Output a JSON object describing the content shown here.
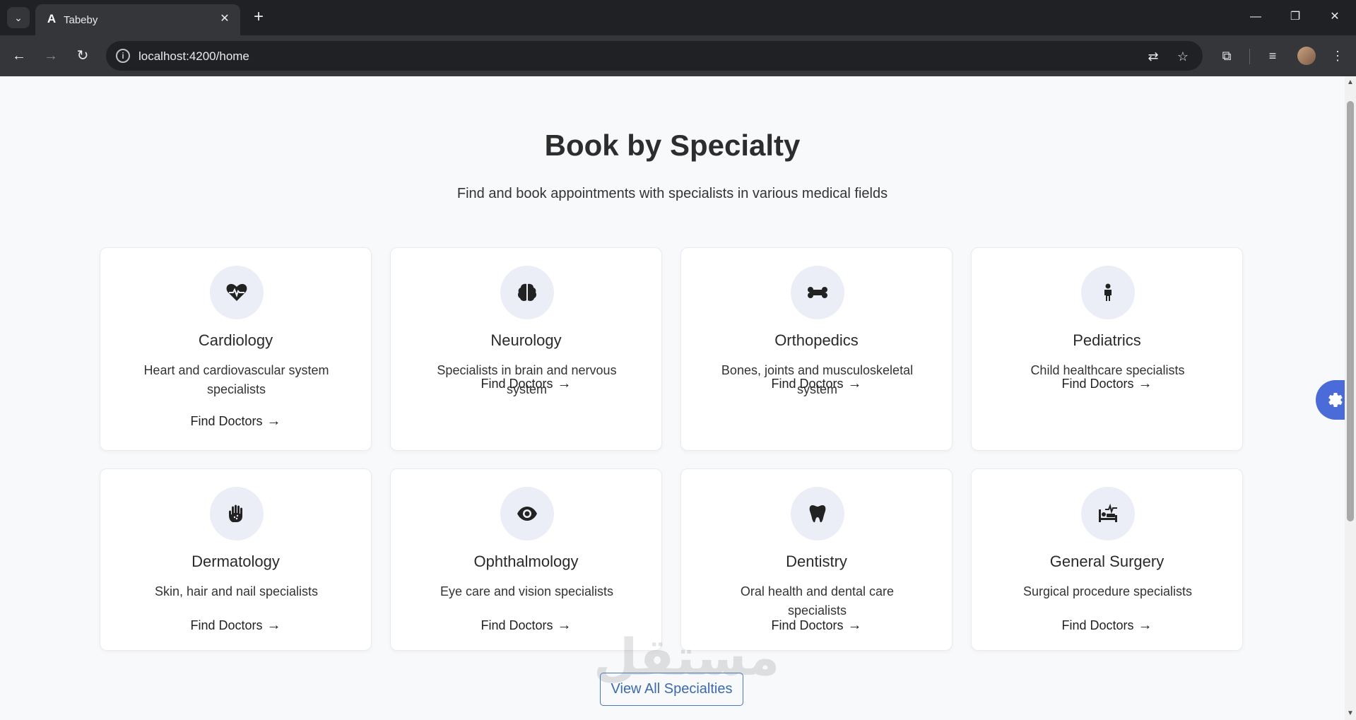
{
  "browser": {
    "tab_title": "Tabeby",
    "url": "localhost:4200/home"
  },
  "section": {
    "title": "Book by Specialty",
    "subtitle": "Find and book appointments with specialists in various medical fields"
  },
  "specialties": [
    {
      "name": "Cardiology",
      "description": "Heart and cardiovascular system specialists",
      "icon": "heartbeat-icon",
      "link": "Find Doctors"
    },
    {
      "name": "Neurology",
      "description": "Specialists in brain and nervous system",
      "icon": "brain-icon",
      "link": "Find Doctors"
    },
    {
      "name": "Orthopedics",
      "description": "Bones, joints and musculoskeletal system",
      "icon": "bone-icon",
      "link": "Find Doctors"
    },
    {
      "name": "Pediatrics",
      "description": "Child healthcare specialists",
      "icon": "child-icon",
      "link": "Find Doctors"
    },
    {
      "name": "Dermatology",
      "description": "Skin, hair and nail specialists",
      "icon": "hand-dots-icon",
      "link": "Find Doctors"
    },
    {
      "name": "Ophthalmology",
      "description": "Eye care and vision specialists",
      "icon": "eye-icon",
      "link": "Find Doctors"
    },
    {
      "name": "Dentistry",
      "description": "Oral health and dental care specialists",
      "icon": "tooth-icon",
      "link": "Find Doctors"
    },
    {
      "name": "General Surgery",
      "description": "Surgical procedure specialists",
      "icon": "bed-pulse-icon",
      "link": "Find Doctors"
    }
  ],
  "view_all_label": "View All Specialties",
  "colors": {
    "accent": "#4b6bd8",
    "icon_bg": "#eceef7",
    "button_border": "#4a78b5"
  }
}
